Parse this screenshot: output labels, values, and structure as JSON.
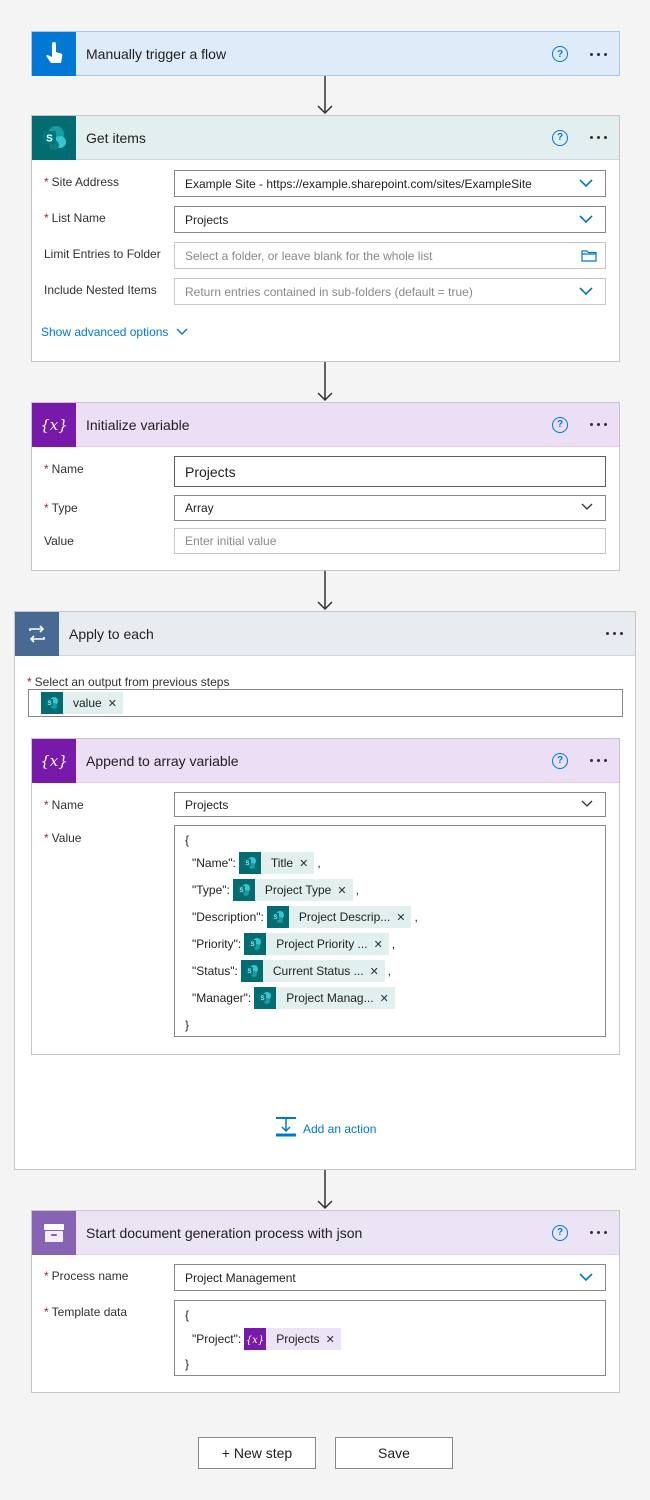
{
  "colors": {
    "trigger": "#0078d4",
    "sharepoint": "#036c70",
    "variable": "#7719aa",
    "loop": "#486991",
    "docgen": "#8763b5",
    "link": "#0078d4"
  },
  "trigger": {
    "title": "Manually trigger a flow",
    "icon": "touch-icon"
  },
  "get_items": {
    "title": "Get items",
    "fields": {
      "site_address": {
        "label": "Site Address",
        "value": "Example Site - https://example.sharepoint.com/sites/ExampleSite"
      },
      "list_name": {
        "label": "List Name",
        "value": "Projects"
      },
      "limit_folder": {
        "label": "Limit Entries to Folder",
        "placeholder": "Select a folder, or leave blank for the whole list"
      },
      "nested": {
        "label": "Include Nested Items",
        "placeholder": "Return entries contained in sub-folders (default = true)"
      }
    },
    "advanced_link": "Show advanced options"
  },
  "init_var": {
    "title": "Initialize variable",
    "fields": {
      "name": {
        "label": "Name",
        "value": "Projects"
      },
      "type": {
        "label": "Type",
        "value": "Array"
      },
      "value": {
        "label": "Value",
        "placeholder": "Enter initial value"
      }
    }
  },
  "apply_each": {
    "title": "Apply to each",
    "output_label": "Select an output from previous steps",
    "output_token": "value",
    "add_action": "Add an action"
  },
  "append": {
    "title": "Append to array variable",
    "name_label": "Name",
    "name_value": "Projects",
    "value_label": "Value",
    "open_brace": "{",
    "close_brace": "}",
    "lines": [
      {
        "key": "\"Name\":",
        "token": "Title",
        "suffix": ","
      },
      {
        "key": "\"Type\":",
        "token": "Project Type",
        "suffix": ","
      },
      {
        "key": "\"Description\":",
        "token": "Project Descrip...",
        "suffix": ","
      },
      {
        "key": "\"Priority\":",
        "token": "Project Priority ...",
        "suffix": ","
      },
      {
        "key": "\"Status\":",
        "token": "Current Status ...",
        "suffix": ","
      },
      {
        "key": "\"Manager\":",
        "token": "Project Manag...",
        "suffix": ""
      }
    ]
  },
  "docgen": {
    "title": "Start document generation process with json",
    "process_label": "Process name",
    "process_value": "Project Management",
    "template_label": "Template data",
    "open_brace": "{",
    "close_brace": "}",
    "key": "\"Project\":",
    "token": "Projects"
  },
  "buttons": {
    "new_step": "+ New step",
    "save": "Save"
  }
}
